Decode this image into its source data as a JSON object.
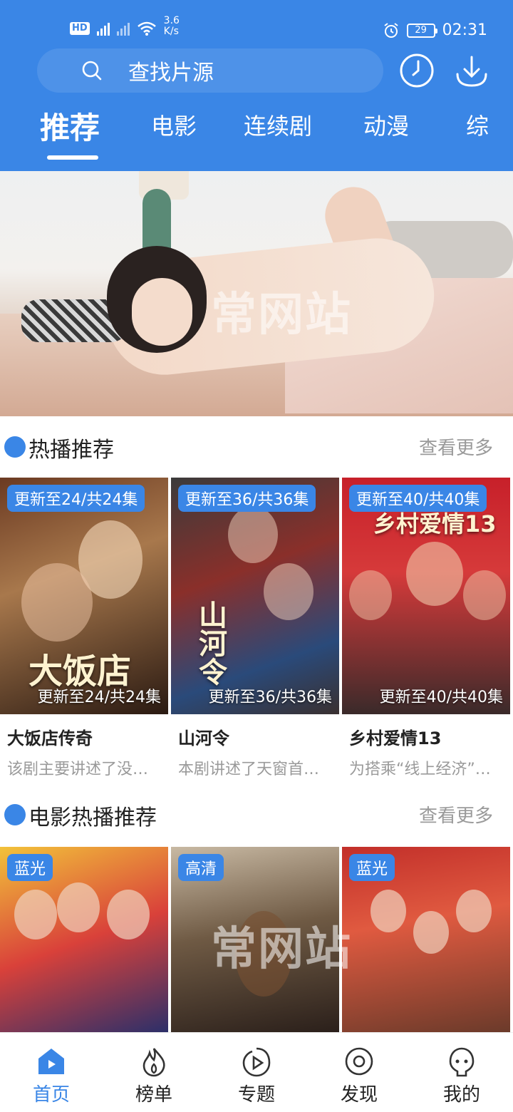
{
  "status_bar": {
    "network_badge": "HD",
    "speed": "3.6",
    "speed_unit": "K/s",
    "battery": "29",
    "time": "02:31"
  },
  "search": {
    "placeholder": "查找片源"
  },
  "tabs": [
    "推荐",
    "电影",
    "连续剧",
    "动漫",
    "综"
  ],
  "watermark": "常网站",
  "section_hot": {
    "title": "热播推荐",
    "more": "查看更多",
    "items": [
      {
        "badge": "更新至24/共24集",
        "caption": "更新至24/共24集",
        "poster_text": "大饭店",
        "title": "大饭店传奇",
        "desc": "该剧主要讲述了没有知识没有文化的..."
      },
      {
        "badge": "更新至36/共36集",
        "caption": "更新至36/共36集",
        "poster_text": "山河令",
        "title": "山河令",
        "desc": "本剧讲述了天窗首领周子舒..."
      },
      {
        "badge": "更新至40/共40集",
        "caption": "更新至40/共40集",
        "poster_text": "乡村爱情13",
        "title": "乡村爱情13",
        "desc": "为搭乘“线上经济”的快车..."
      }
    ]
  },
  "section_movie": {
    "title": "电影热播推荐",
    "more": "查看更多",
    "items": [
      {
        "badge": "蓝光"
      },
      {
        "badge": "高清"
      },
      {
        "badge": "蓝光"
      }
    ]
  },
  "bottom_nav": [
    {
      "label": "首页",
      "icon": "home-icon"
    },
    {
      "label": "榜单",
      "icon": "fire-icon"
    },
    {
      "label": "专题",
      "icon": "play-topic-icon"
    },
    {
      "label": "发现",
      "icon": "discover-icon"
    },
    {
      "label": "我的",
      "icon": "profile-icon"
    }
  ],
  "colors": {
    "accent": "#3a86e6",
    "muted": "#9a9a9a"
  }
}
